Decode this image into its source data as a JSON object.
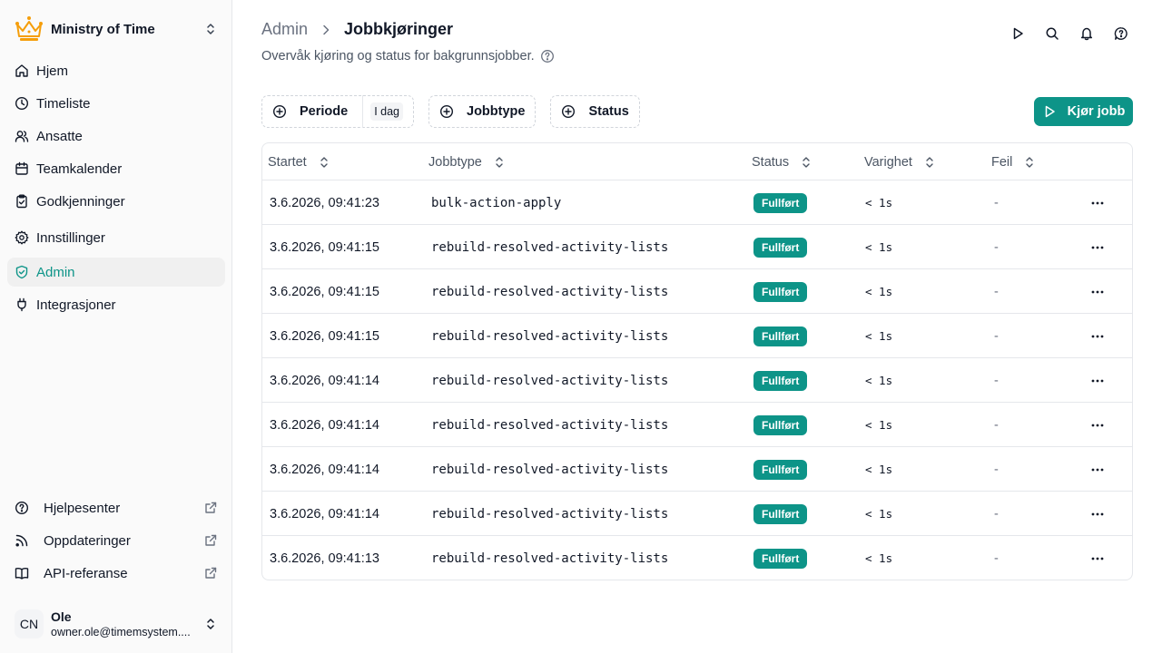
{
  "sidebar": {
    "org_name": "Ministry of Time",
    "nav": [
      {
        "label": "Hjem",
        "icon": "home-icon"
      },
      {
        "label": "Timeliste",
        "icon": "clock-icon"
      },
      {
        "label": "Ansatte",
        "icon": "users-icon"
      },
      {
        "label": "Teamkalender",
        "icon": "calendar-icon"
      },
      {
        "label": "Godkjenninger",
        "icon": "clipboard-check-icon"
      },
      {
        "label": "Innstillinger",
        "icon": "gear-icon"
      },
      {
        "label": "Admin",
        "icon": "shield-check-icon",
        "active": true
      },
      {
        "label": "Integrasjoner",
        "icon": "plug-icon"
      }
    ],
    "external": [
      {
        "label": "Hjelpesenter",
        "icon": "help-circle-icon"
      },
      {
        "label": "Oppdateringer",
        "icon": "rss-icon"
      },
      {
        "label": "API-referanse",
        "icon": "book-icon"
      }
    ],
    "user": {
      "initials": "CN",
      "name": "Ole",
      "email": "owner.ole@timemsystem...."
    }
  },
  "header": {
    "breadcrumb_root": "Admin",
    "title": "Jobbkjøringer",
    "subtitle": "Overvåk kjøring og status for bakgrunnsjobber."
  },
  "filters": {
    "periode": "Periode",
    "periode_value": "I dag",
    "jobbtype": "Jobbtype",
    "status": "Status"
  },
  "run_button": {
    "prefix": "K",
    "underlined": "j",
    "rest": "ør jobb"
  },
  "table": {
    "columns": [
      "Startet",
      "Jobbtype",
      "Status",
      "Varighet",
      "Feil"
    ],
    "rows": [
      {
        "started": "3.6.2026, 09:41:23",
        "type": "bulk-action-apply",
        "status": "Fullført",
        "duration": "< 1s",
        "error": "-"
      },
      {
        "started": "3.6.2026, 09:41:15",
        "type": "rebuild-resolved-activity-lists",
        "status": "Fullført",
        "duration": "< 1s",
        "error": "-"
      },
      {
        "started": "3.6.2026, 09:41:15",
        "type": "rebuild-resolved-activity-lists",
        "status": "Fullført",
        "duration": "< 1s",
        "error": "-"
      },
      {
        "started": "3.6.2026, 09:41:15",
        "type": "rebuild-resolved-activity-lists",
        "status": "Fullført",
        "duration": "< 1s",
        "error": "-"
      },
      {
        "started": "3.6.2026, 09:41:14",
        "type": "rebuild-resolved-activity-lists",
        "status": "Fullført",
        "duration": "< 1s",
        "error": "-"
      },
      {
        "started": "3.6.2026, 09:41:14",
        "type": "rebuild-resolved-activity-lists",
        "status": "Fullført",
        "duration": "< 1s",
        "error": "-"
      },
      {
        "started": "3.6.2026, 09:41:14",
        "type": "rebuild-resolved-activity-lists",
        "status": "Fullført",
        "duration": "< 1s",
        "error": "-"
      },
      {
        "started": "3.6.2026, 09:41:14",
        "type": "rebuild-resolved-activity-lists",
        "status": "Fullført",
        "duration": "< 1s",
        "error": "-"
      },
      {
        "started": "3.6.2026, 09:41:13",
        "type": "rebuild-resolved-activity-lists",
        "status": "Fullført",
        "duration": "< 1s",
        "error": "-"
      }
    ]
  },
  "colors": {
    "accent": "#0d9488",
    "logo": "#f59e0b"
  }
}
